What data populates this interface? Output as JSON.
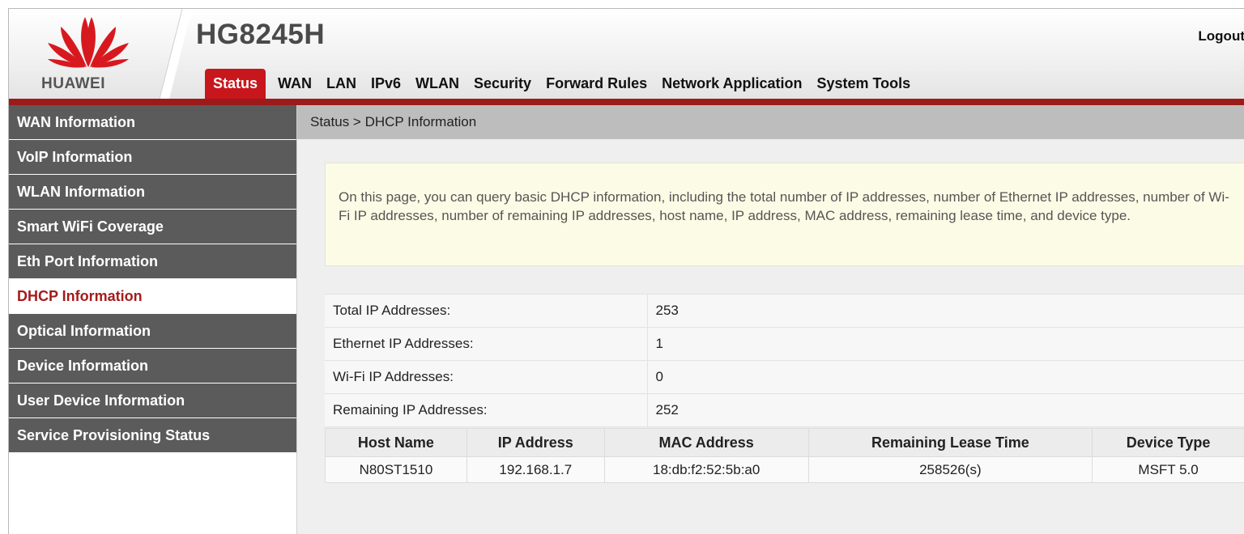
{
  "header": {
    "brand": "HUAWEI",
    "model": "HG8245H",
    "logout_label": "Logout",
    "brand_color": "#c8161d"
  },
  "nav": {
    "tabs": [
      {
        "label": "Status",
        "active": true
      },
      {
        "label": "WAN"
      },
      {
        "label": "LAN"
      },
      {
        "label": "IPv6"
      },
      {
        "label": "WLAN"
      },
      {
        "label": "Security"
      },
      {
        "label": "Forward Rules"
      },
      {
        "label": "Network Application"
      },
      {
        "label": "System Tools"
      }
    ]
  },
  "sidebar": {
    "items": [
      {
        "label": "WAN Information"
      },
      {
        "label": "VoIP Information"
      },
      {
        "label": "WLAN Information"
      },
      {
        "label": "Smart WiFi Coverage"
      },
      {
        "label": "Eth Port Information"
      },
      {
        "label": "DHCP Information",
        "active": true
      },
      {
        "label": "Optical Information"
      },
      {
        "label": "Device Information"
      },
      {
        "label": "User Device Information"
      },
      {
        "label": "Service Provisioning Status"
      }
    ]
  },
  "main": {
    "breadcrumb": "Status > DHCP Information",
    "description": "On this page, you can query basic DHCP information, including the total number of IP addresses, number of Ethernet IP addresses, number of Wi-Fi IP addresses, number of remaining IP addresses, host name, IP address, MAC address, remaining lease time, and device type.",
    "summary": [
      {
        "label": "Total IP Addresses:",
        "value": "253"
      },
      {
        "label": "Ethernet IP Addresses:",
        "value": "1"
      },
      {
        "label": "Wi-Fi IP Addresses:",
        "value": "0"
      },
      {
        "label": "Remaining IP Addresses:",
        "value": "252"
      }
    ],
    "hosts": {
      "columns": [
        "Host Name",
        "IP Address",
        "MAC Address",
        "Remaining Lease Time",
        "Device Type"
      ],
      "rows": [
        [
          "N80ST1510",
          "192.168.1.7",
          "18:db:f2:52:5b:a0",
          "258526(s)",
          "MSFT 5.0"
        ]
      ]
    }
  }
}
